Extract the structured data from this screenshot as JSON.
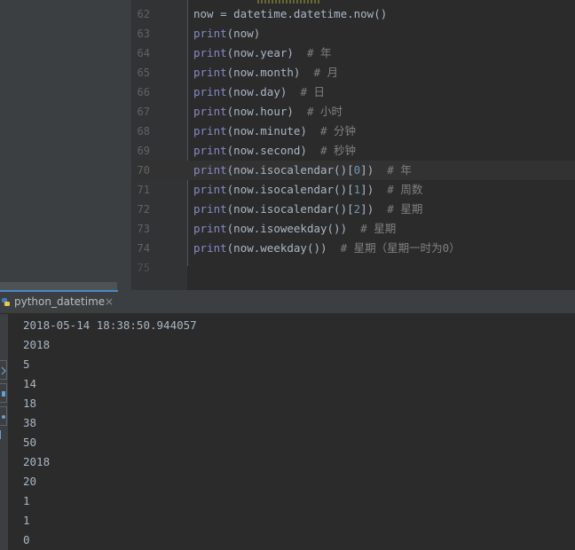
{
  "editor": {
    "lines": [
      {
        "num": "62",
        "tokens": [
          {
            "t": "now = datetime.datetime.now()",
            "c": ""
          }
        ]
      },
      {
        "num": "63",
        "tokens": [
          {
            "t": "print",
            "c": "kw"
          },
          {
            "t": "(now)",
            "c": ""
          }
        ]
      },
      {
        "num": "64",
        "tokens": [
          {
            "t": "print",
            "c": "kw"
          },
          {
            "t": "(now.year)  ",
            "c": ""
          },
          {
            "t": "# 年",
            "c": "cm"
          }
        ]
      },
      {
        "num": "65",
        "tokens": [
          {
            "t": "print",
            "c": "kw"
          },
          {
            "t": "(now.month)  ",
            "c": ""
          },
          {
            "t": "# 月",
            "c": "cm"
          }
        ]
      },
      {
        "num": "66",
        "tokens": [
          {
            "t": "print",
            "c": "kw"
          },
          {
            "t": "(now.day)  ",
            "c": ""
          },
          {
            "t": "# 日",
            "c": "cm"
          }
        ]
      },
      {
        "num": "67",
        "tokens": [
          {
            "t": "print",
            "c": "kw"
          },
          {
            "t": "(now.hour)  ",
            "c": ""
          },
          {
            "t": "# 小时",
            "c": "cm"
          }
        ]
      },
      {
        "num": "68",
        "tokens": [
          {
            "t": "print",
            "c": "kw"
          },
          {
            "t": "(now.minute)  ",
            "c": ""
          },
          {
            "t": "# 分钟",
            "c": "cm"
          }
        ]
      },
      {
        "num": "69",
        "tokens": [
          {
            "t": "print",
            "c": "kw"
          },
          {
            "t": "(now.second)  ",
            "c": ""
          },
          {
            "t": "# 秒钟",
            "c": "cm"
          }
        ]
      },
      {
        "num": "70",
        "tokens": [
          {
            "t": "print",
            "c": "kw"
          },
          {
            "t": "(now.isocalendar()[",
            "c": ""
          },
          {
            "t": "0",
            "c": "num"
          },
          {
            "t": "])  ",
            "c": ""
          },
          {
            "t": "# 年",
            "c": "cm"
          }
        ],
        "current": true
      },
      {
        "num": "71",
        "tokens": [
          {
            "t": "print",
            "c": "kw"
          },
          {
            "t": "(now.isocalendar()[",
            "c": ""
          },
          {
            "t": "1",
            "c": "num"
          },
          {
            "t": "])  ",
            "c": ""
          },
          {
            "t": "# 周数",
            "c": "cm"
          }
        ]
      },
      {
        "num": "72",
        "tokens": [
          {
            "t": "print",
            "c": "kw"
          },
          {
            "t": "(now.isocalendar()[",
            "c": ""
          },
          {
            "t": "2",
            "c": "num"
          },
          {
            "t": "])  ",
            "c": ""
          },
          {
            "t": "# 星期",
            "c": "cm"
          }
        ]
      },
      {
        "num": "73",
        "tokens": [
          {
            "t": "print",
            "c": "kw"
          },
          {
            "t": "(now.isoweekday())  ",
            "c": ""
          },
          {
            "t": "# 星期",
            "c": "cm"
          }
        ]
      },
      {
        "num": "74",
        "tokens": [
          {
            "t": "print",
            "c": "kw"
          },
          {
            "t": "(now.weekday())  ",
            "c": ""
          },
          {
            "t": "# 星期（星期一时为0）",
            "c": "cm"
          }
        ]
      },
      {
        "num": "75",
        "tokens": []
      }
    ]
  },
  "run": {
    "tab_label": "python_datetime",
    "close_glyph": "×",
    "output": [
      "2018-05-14 18:38:50.944057",
      "2018",
      "5",
      "14",
      "18",
      "38",
      "50",
      "2018",
      "20",
      "1",
      "1",
      "0"
    ]
  },
  "icons": [
    "python-icon",
    "rerun-icon",
    "stop-icon",
    "restore-icon"
  ],
  "colors": {
    "keyword": "#8888c6",
    "comment": "#808080",
    "number": "#6897bb",
    "text": "#a9b7c6",
    "background": "#2b2b2b"
  }
}
